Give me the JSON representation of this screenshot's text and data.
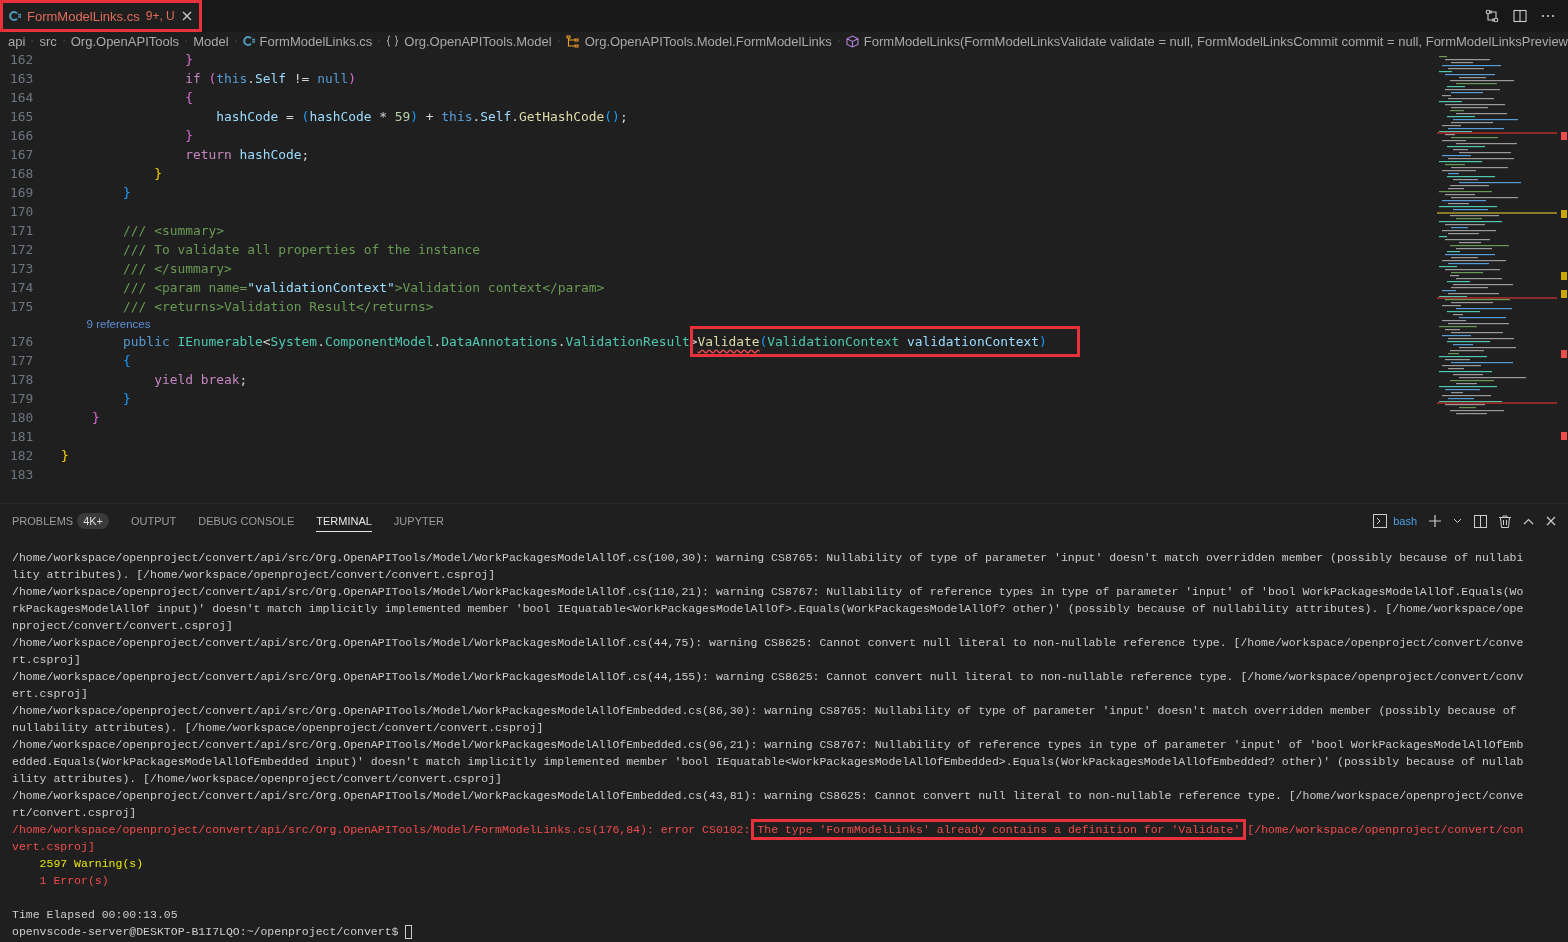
{
  "tab": {
    "label": "FormModelLinks.cs",
    "badge": "9+, U",
    "selected": true,
    "highlighted": true
  },
  "breadcrumbs": [
    {
      "label": "api",
      "kind": "folder"
    },
    {
      "label": "src",
      "kind": "folder"
    },
    {
      "label": "Org.OpenAPITools",
      "kind": "folder"
    },
    {
      "label": "Model",
      "kind": "folder"
    },
    {
      "label": "FormModelLinks.cs",
      "kind": "file"
    },
    {
      "label": "Org.OpenAPITools.Model",
      "kind": "namespace"
    },
    {
      "label": "Org.OpenAPITools.Model.FormModelLinks",
      "kind": "class"
    },
    {
      "label": "FormModelLinks(FormModelLinksValidate validate = null, FormModelLinksCommit commit = null, FormModelLinksPreview",
      "kind": "method"
    }
  ],
  "code_lines": [
    {
      "number": "162",
      "tokens": [
        {
          "text": "                }",
          "kind": "brace2"
        }
      ]
    },
    {
      "number": "163",
      "tokens": [
        {
          "text": "                if ",
          "kind": "control"
        },
        {
          "text": "(",
          "kind": "brace2"
        },
        {
          "text": "this",
          "kind": "keyword"
        },
        {
          "text": ".",
          "kind": "plain"
        },
        {
          "text": "Self",
          "kind": "variable"
        },
        {
          "text": " != ",
          "kind": "plain"
        },
        {
          "text": "null",
          "kind": "keyword"
        },
        {
          "text": ")",
          "kind": "brace2"
        }
      ]
    },
    {
      "number": "164",
      "tokens": [
        {
          "text": "                {",
          "kind": "brace2"
        }
      ]
    },
    {
      "number": "165",
      "tokens": [
        {
          "text": "                    hashCode",
          "kind": "variable"
        },
        {
          "text": " = ",
          "kind": "plain"
        },
        {
          "text": "(",
          "kind": "brace3"
        },
        {
          "text": "hashCode",
          "kind": "variable"
        },
        {
          "text": " * ",
          "kind": "plain"
        },
        {
          "text": "59",
          "kind": "number"
        },
        {
          "text": ")",
          "kind": "brace3"
        },
        {
          "text": " + ",
          "kind": "plain"
        },
        {
          "text": "this",
          "kind": "keyword"
        },
        {
          "text": ".",
          "kind": "plain"
        },
        {
          "text": "Self",
          "kind": "variable"
        },
        {
          "text": ".",
          "kind": "plain"
        },
        {
          "text": "GetHashCode",
          "kind": "method"
        },
        {
          "text": "()",
          "kind": "brace3"
        },
        {
          "text": ";",
          "kind": "plain"
        }
      ]
    },
    {
      "number": "166",
      "tokens": [
        {
          "text": "                }",
          "kind": "brace2"
        }
      ]
    },
    {
      "number": "167",
      "tokens": [
        {
          "text": "                return ",
          "kind": "control"
        },
        {
          "text": "hashCode",
          "kind": "variable"
        },
        {
          "text": ";",
          "kind": "plain"
        }
      ]
    },
    {
      "number": "168",
      "tokens": [
        {
          "text": "            }",
          "kind": "brace1"
        }
      ]
    },
    {
      "number": "169",
      "tokens": [
        {
          "text": "        }",
          "kind": "brace3"
        }
      ]
    },
    {
      "number": "170"
    },
    {
      "number": "171",
      "tokens": [
        {
          "text": "        /// <summary>",
          "kind": "comment"
        }
      ]
    },
    {
      "number": "172",
      "tokens": [
        {
          "text": "        /// To validate all properties of the instance",
          "kind": "comment"
        }
      ]
    },
    {
      "number": "173",
      "tokens": [
        {
          "text": "        /// </summary>",
          "kind": "comment"
        }
      ]
    },
    {
      "number": "174",
      "tokens": [
        {
          "text": "        /// <param name=",
          "kind": "comment"
        },
        {
          "text": "\"validationContext\"",
          "kind": "docstring"
        },
        {
          "text": ">Validation context</param>",
          "kind": "comment"
        }
      ]
    },
    {
      "number": "175",
      "tokens": [
        {
          "text": "        /// <returns>Validation Result</returns>",
          "kind": "comment"
        }
      ]
    },
    {
      "codelens": "        9 references",
      "number": "176",
      "tokens": [
        {
          "text": "        public ",
          "kind": "keyword"
        },
        {
          "text": "IEnumerable",
          "kind": "type"
        },
        {
          "text": "<",
          "kind": "plain"
        },
        {
          "text": "System",
          "kind": "type"
        },
        {
          "text": ".",
          "kind": "plain"
        },
        {
          "text": "ComponentModel",
          "kind": "type"
        },
        {
          "text": ".",
          "kind": "plain"
        },
        {
          "text": "DataAnnotations",
          "kind": "type"
        },
        {
          "text": ".",
          "kind": "plain"
        },
        {
          "text": "ValidationResult",
          "kind": "type"
        },
        {
          "text": ">",
          "kind": "plain"
        }
      ],
      "boxed_tokens": [
        {
          "text": "Validate",
          "kind": "method",
          "error": true
        },
        {
          "text": "(",
          "kind": "brace3"
        },
        {
          "text": "ValidationContext ",
          "kind": "type"
        },
        {
          "text": "validationContext",
          "kind": "variable"
        },
        {
          "text": ")",
          "kind": "brace3"
        }
      ]
    },
    {
      "number": "177",
      "tokens": [
        {
          "text": "        {",
          "kind": "brace3"
        }
      ]
    },
    {
      "number": "178",
      "tokens": [
        {
          "text": "            yield break",
          "kind": "control"
        },
        {
          "text": ";",
          "kind": "plain"
        }
      ]
    },
    {
      "number": "179",
      "tokens": [
        {
          "text": "        }",
          "kind": "brace3"
        }
      ]
    },
    {
      "number": "180",
      "tokens": [
        {
          "text": "    }",
          "kind": "brace2"
        }
      ]
    },
    {
      "number": "181"
    },
    {
      "number": "182",
      "tokens": [
        {
          "text": "}",
          "kind": "brace1"
        }
      ]
    },
    {
      "number": "183"
    }
  ],
  "panel_tabs": [
    {
      "label": "PROBLEMS",
      "badge": "4K+",
      "selected": false
    },
    {
      "label": "OUTPUT",
      "selected": false
    },
    {
      "label": "DEBUG CONSOLE",
      "selected": false
    },
    {
      "label": "TERMINAL",
      "selected": true
    },
    {
      "label": "JUPYTER",
      "selected": false
    }
  ],
  "terminal_name": "bash",
  "terminal_lines": [
    {
      "kind": "normal",
      "text": "/home/workspace/openproject/convert/api/src/Org.OpenAPITools/Model/WorkPackagesModelAllOf.cs(100,30): warning CS8765: Nullability of type of parameter 'input' doesn't match overridden member (possibly because of nullabi"
    },
    {
      "kind": "normal",
      "text": "lity attributes). [/home/workspace/openproject/convert/convert.csproj]"
    },
    {
      "kind": "normal",
      "text": "/home/workspace/openproject/convert/api/src/Org.OpenAPITools/Model/WorkPackagesModelAllOf.cs(110,21): warning CS8767: Nullability of reference types in type of parameter 'input' of 'bool WorkPackagesModelAllOf.Equals(Wo"
    },
    {
      "kind": "normal",
      "text": "rkPackagesModelAllOf input)' doesn't match implicitly implemented member 'bool IEquatable<WorkPackagesModelAllOf>.Equals(WorkPackagesModelAllOf? other)' (possibly because of nullability attributes). [/home/workspace/ope"
    },
    {
      "kind": "normal",
      "text": "nproject/convert/convert.csproj]"
    },
    {
      "kind": "normal",
      "text": "/home/workspace/openproject/convert/api/src/Org.OpenAPITools/Model/WorkPackagesModelAllOf.cs(44,75): warning CS8625: Cannot convert null literal to non-nullable reference type. [/home/workspace/openproject/convert/conve"
    },
    {
      "kind": "normal",
      "text": "rt.csproj]"
    },
    {
      "kind": "normal",
      "text": "/home/workspace/openproject/convert/api/src/Org.OpenAPITools/Model/WorkPackagesModelAllOf.cs(44,155): warning CS8625: Cannot convert null literal to non-nullable reference type. [/home/workspace/openproject/convert/conv"
    },
    {
      "kind": "normal",
      "text": "ert.csproj]"
    },
    {
      "kind": "normal",
      "text": "/home/workspace/openproject/convert/api/src/Org.OpenAPITools/Model/WorkPackagesModelAllOfEmbedded.cs(86,30): warning CS8765: Nullability of type of parameter 'input' doesn't match overridden member (possibly because of"
    },
    {
      "kind": "normal",
      "text": "nullability attributes). [/home/workspace/openproject/convert/convert.csproj]"
    },
    {
      "kind": "normal",
      "text": "/home/workspace/openproject/convert/api/src/Org.OpenAPITools/Model/WorkPackagesModelAllOfEmbedded.cs(96,21): warning CS8767: Nullability of reference types in type of parameter 'input' of 'bool WorkPackagesModelAllOfEmb"
    },
    {
      "kind": "normal",
      "text": "edded.Equals(WorkPackagesModelAllOfEmbedded input)' doesn't match implicitly implemented member 'bool IEquatable<WorkPackagesModelAllOfEmbedded>.Equals(WorkPackagesModelAllOfEmbedded? other)' (possibly because of nullab"
    },
    {
      "kind": "normal",
      "text": "ility attributes). [/home/workspace/openproject/convert/convert.csproj]"
    },
    {
      "kind": "normal",
      "text": "/home/workspace/openproject/convert/api/src/Org.OpenAPITools/Model/WorkPackagesModelAllOfEmbedded.cs(43,81): warning CS8625: Cannot convert null literal to non-nullable reference type. [/home/workspace/openproject/conve"
    },
    {
      "kind": "normal",
      "text": "rt/convert.csproj]"
    },
    {
      "kind": "error",
      "text": "/home/workspace/openproject/convert/api/src/Org.OpenAPITools/Model/FormModelLinks.cs(176,84): error CS0102: ",
      "boxed": "The type 'FormModelLinks' already contains a definition for 'Validate'",
      "after": " [/home/workspace/openproject/convert/con"
    },
    {
      "kind": "error",
      "text": "vert.csproj]"
    },
    {
      "kind": "warning",
      "text": "    2597 Warning(s)"
    },
    {
      "kind": "error",
      "text": "    1 Error(s)"
    },
    {
      "kind": "blank"
    },
    {
      "kind": "normal",
      "text": "Time Elapsed 00:00:13.05"
    },
    {
      "kind": "prompt",
      "text": "openvscode-server@DESKTOP-B1I7LQO:~/openproject/convert$ "
    }
  ]
}
